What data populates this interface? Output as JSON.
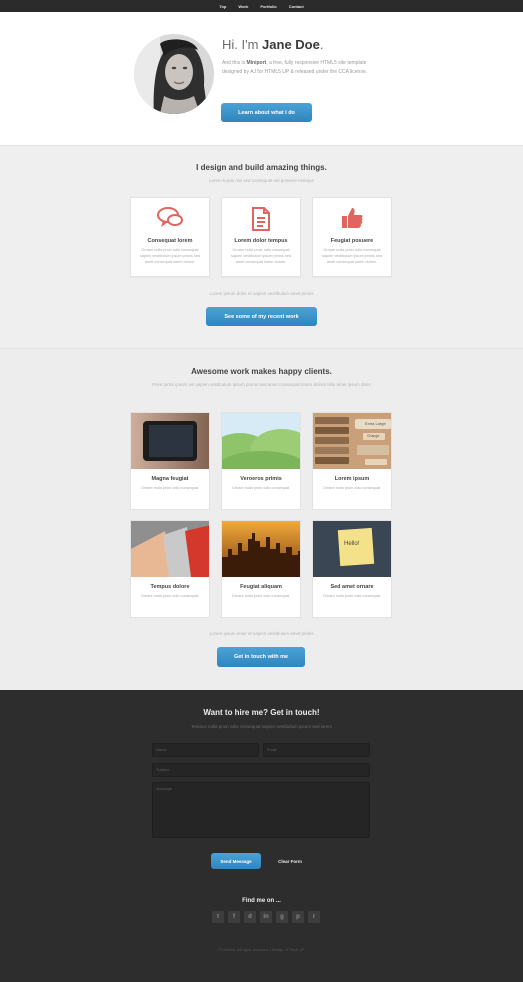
{
  "nav": {
    "items": [
      "Top",
      "Work",
      "Portfolio",
      "Contact"
    ]
  },
  "hero": {
    "greeting": "Hi. I'm ",
    "name": "Jane Doe",
    "period": ".",
    "desc_prefix": "And this is ",
    "desc_brand": "Miniport",
    "desc_rest": ", a free, fully responsive HTML5 site template designed by AJ for HTML5 UP & released under the CCA license.",
    "button": "Learn about what I do"
  },
  "about": {
    "title": "I design and build amazing things.",
    "subtitle": "Lorem turpis nisl sed consequat vel posuere tristique",
    "features": [
      {
        "title": "Consequat lorem",
        "icon": "chat-bubbles-icon",
        "desc": "Ornare nulla proin odio consequat sapien vestibulum ipsum primis sed amet consequat lorem dolore."
      },
      {
        "title": "Lorem dolor tempus",
        "icon": "document-icon",
        "desc": "Ornare nulla proin odio consequat sapien vestibulum ipsum primis sed amet consequat lorem dolore."
      },
      {
        "title": "Feugiat posuere",
        "icon": "thumbs-up-icon",
        "desc": "Ornare nulla proin odio consequat sapien vestibulum ipsum primis sed amet consequat lorem dolore."
      }
    ],
    "footnote": "Lorem ipsum dolor et sapien vestibulum amet primis",
    "button": "See some of my recent work"
  },
  "work": {
    "title": "Awesome work makes happy clients.",
    "subtitle": "Prise tortor ipsum vel sapien vestibulum ipsum primis sed amet consequat lorem dolore felis amet ipsum dolor",
    "cards": [
      {
        "title": "Magna feugiat",
        "desc": "Ornare nulla proin odio consequat."
      },
      {
        "title": "Veroeros primis",
        "desc": "Ornare nulla proin odio consequat."
      },
      {
        "title": "Lorem ipsum",
        "desc": "Ornare nulla proin odio consequat."
      },
      {
        "title": "Tempus dolore",
        "desc": "Ornare nulla proin odio consequat."
      },
      {
        "title": "Feugiat aliquam",
        "desc": "Ornare nulla proin odio consequat."
      },
      {
        "title": "Sed amet ornare",
        "desc": "Ornare nulla proin odio consequat."
      }
    ],
    "thumb_text": {
      "extra_large": "Extra Large",
      "change": "Change",
      "hello": "Hello!"
    },
    "footnote": "Lorem ipsum dolor et sapien vestibulum amet primis",
    "button": "Get in touch with me"
  },
  "contact": {
    "title": "Want to hire me? Get in touch!",
    "subtitle": "Tempus nulla proin odio consequat sapien vestibulum ipsum sed lorem",
    "name_placeholder": "Name",
    "email_placeholder": "Email",
    "subject_placeholder": "Subject",
    "message_placeholder": "Message",
    "send": "Send Message",
    "clear": "Clear Form",
    "find": "Find me on ...",
    "social": [
      "t",
      "f",
      "d",
      "in",
      "g",
      "p",
      "r"
    ],
    "footer": "© Untitled. All rights reserved. | Design: HTML5 UP"
  },
  "colors": {
    "accent": "#3a93cc",
    "icon": "#e06560",
    "dark": "#2d2d2d"
  }
}
